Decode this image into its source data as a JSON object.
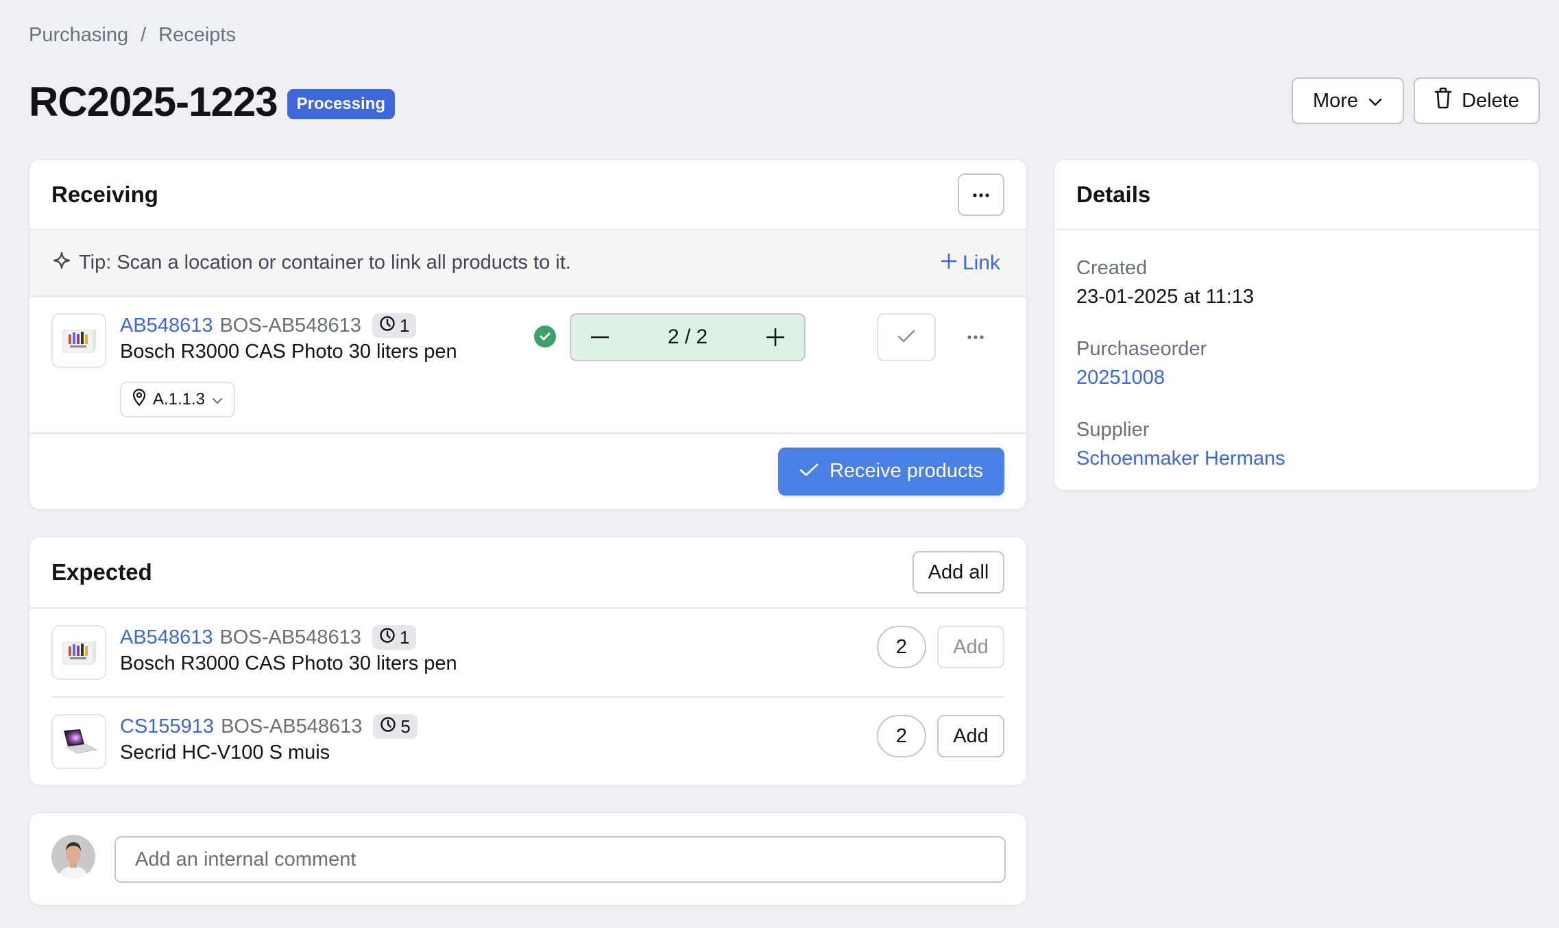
{
  "breadcrumb": {
    "items": [
      "Purchasing",
      "Receipts"
    ],
    "separator": "/"
  },
  "header": {
    "title": "RC2025-1223",
    "status": "Processing",
    "more_label": "More",
    "delete_label": "Delete"
  },
  "colors": {
    "accent": "#3e67dc",
    "primary_button": "#4a7fe6",
    "success": "#3fa06a",
    "stepper_bg": "#ddf1e5",
    "page_bg": "#eff0f4"
  },
  "receiving": {
    "title": "Receiving",
    "menu_icon": "ellipsis-icon",
    "tip": "Tip: Scan a location or container to link all products to it.",
    "tip_icon": "sparkle-icon",
    "link_label": "Link",
    "items": [
      {
        "sku": "AB548613",
        "code": "BOS-AB548613",
        "count": "1",
        "name": "Bosch R3000 CAS Photo 30 liters pen",
        "location": "A.1.1.3",
        "quantity": "2 / 2",
        "status": "complete"
      }
    ],
    "receive_label": "Receive products"
  },
  "expected": {
    "title": "Expected",
    "add_all_label": "Add all",
    "items": [
      {
        "sku": "AB548613",
        "code": "BOS-AB548613",
        "count": "1",
        "name": "Bosch R3000 CAS Photo 30 liters pen",
        "quantity": "2",
        "add_label": "Add",
        "add_enabled": false
      },
      {
        "sku": "CS155913",
        "code": "BOS-AB548613",
        "count": "5",
        "name": "Secrid HC-V100 S muis",
        "quantity": "2",
        "add_label": "Add",
        "add_enabled": true
      }
    ]
  },
  "comment": {
    "placeholder": "Add an internal comment",
    "value": ""
  },
  "details": {
    "title": "Details",
    "fields": [
      {
        "label": "Created",
        "value": "23-01-2025 at 11:13",
        "is_link": false
      },
      {
        "label": "Purchaseorder",
        "value": "20251008",
        "is_link": true
      },
      {
        "label": "Supplier",
        "value": "Schoenmaker Hermans",
        "is_link": true
      }
    ]
  }
}
